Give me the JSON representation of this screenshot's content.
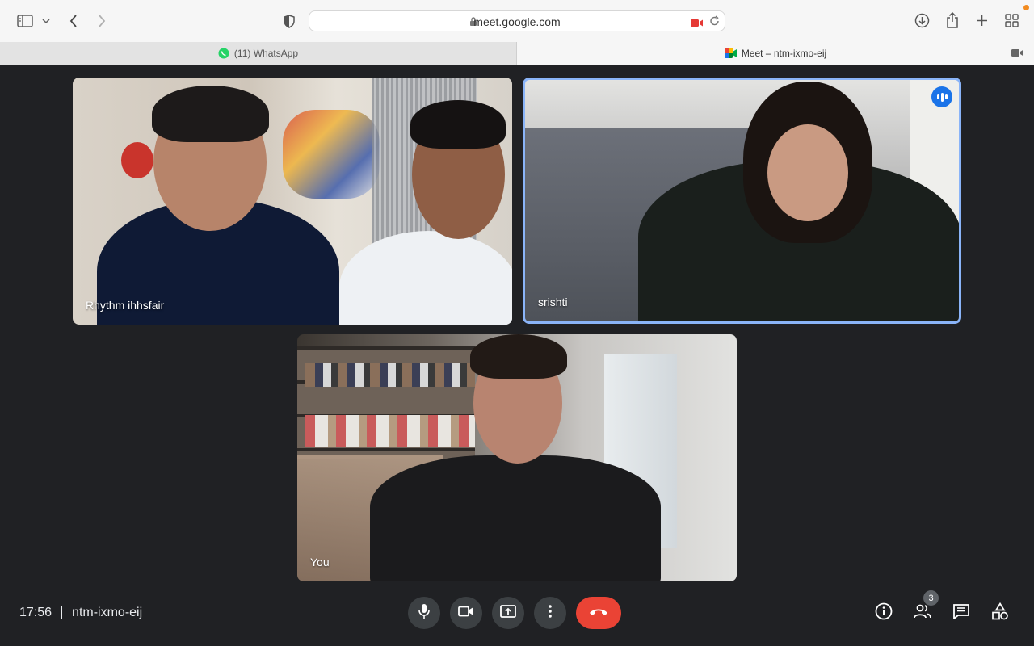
{
  "browser": {
    "url": "meet.google.com",
    "tabs": [
      {
        "label": "(11) WhatsApp",
        "active": false
      },
      {
        "label": "Meet – ntm-ixmo-eij",
        "active": true
      }
    ]
  },
  "tiles": [
    {
      "name": "Rhythm ihhsfair",
      "speaking": false
    },
    {
      "name": "srishti",
      "speaking": true
    },
    {
      "name": "You",
      "speaking": false
    }
  ],
  "meeting": {
    "time": "17:56",
    "code": "ntm-ixmo-eij",
    "participant_count": "3"
  },
  "icons": {
    "sidebar": "sidebar-icon",
    "back": "chevron-left-icon",
    "forward": "chevron-right-icon",
    "shield": "shield-icon",
    "download": "download-icon",
    "share": "share-icon",
    "new_tab": "plus-icon",
    "tab_overview": "grid-icon",
    "mic": "mic-icon",
    "camera": "camera-icon",
    "present": "present-icon",
    "more": "more-vert-icon",
    "hangup": "hangup-icon",
    "info": "info-icon",
    "people": "people-icon",
    "chat": "chat-icon",
    "activities": "activities-icon"
  },
  "colors": {
    "meet_bg": "#202124",
    "hangup": "#ea4335",
    "active_speaker": "#8ab4f8",
    "speaking_badge": "#1a73e8"
  }
}
